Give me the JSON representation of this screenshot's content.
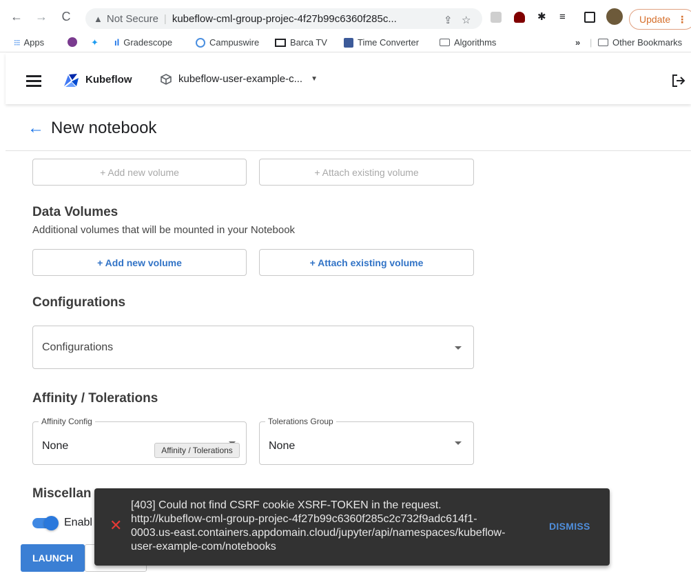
{
  "browser": {
    "security_label": "Not Secure",
    "url": "kubeflow-cml-group-projec-4f27b99c6360f285c...",
    "update_label": "Update",
    "bookmarks": [
      "Apps",
      "Gradescope",
      "Campuswire",
      "Barca TV",
      "Time Converter",
      "Algorithms"
    ],
    "other_bookmarks": "Other Bookmarks",
    "overflow": "»"
  },
  "header": {
    "brand": "Kubeflow",
    "namespace": "kubeflow-user-example-c..."
  },
  "page": {
    "title": "New notebook"
  },
  "workspace_volume": {
    "add_label": "+ Add new volume",
    "attach_label": "+ Attach existing volume"
  },
  "data_volumes": {
    "title": "Data Volumes",
    "subtitle": "Additional volumes that will be mounted in your Notebook",
    "add_label": "+ Add new volume",
    "attach_label": "+ Attach existing volume"
  },
  "configurations": {
    "title": "Configurations",
    "placeholder": "Configurations"
  },
  "affinity": {
    "title": "Affinity / Tolerations",
    "affinity_label": "Affinity Config",
    "affinity_value": "None",
    "tolerations_label": "Tolerations Group",
    "tolerations_value": "None",
    "tooltip": "Affinity / Tolerations"
  },
  "misc": {
    "title_visible": "Miscellan",
    "toggle_label_visible": "Enabl",
    "toggle_on": true
  },
  "actions": {
    "launch": "LAUNCH"
  },
  "snackbar": {
    "message": "[403] Could not find CSRF cookie XSRF-TOKEN in the request. http://kubeflow-cml-group-projec-4f27b99c6360f285c2c732f9adc614f1-0003.us-east.containers.appdomain.cloud/jupyter/api/namespaces/kubeflow-user-example-com/notebooks",
    "dismiss": "DISMISS"
  },
  "colors": {
    "primary": "#3b7fd4",
    "error": "#e53935",
    "snackbar_bg": "#323232"
  }
}
